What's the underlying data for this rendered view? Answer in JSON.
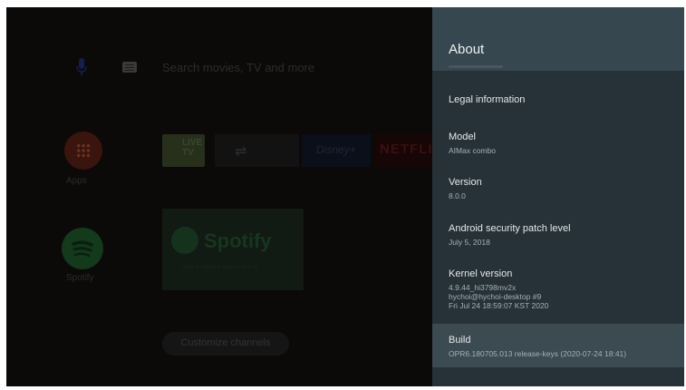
{
  "launcher": {
    "search_placeholder": "Search movies, TV and more",
    "apps_label": "Apps",
    "spotify_label": "Spotify",
    "live_tv_label": "LIVE TV",
    "disney_label": "Disney+",
    "netflix_label": "NETFLIX",
    "spotify_card_brand": "Spotify",
    "spotify_card_sub": "Listen to millions of songs on your TV",
    "customize_label": "Customize channels"
  },
  "panel": {
    "title": "About",
    "items": [
      {
        "title": "Legal information",
        "subtitle": ""
      },
      {
        "title": "Model",
        "subtitle": "AIMax combo"
      },
      {
        "title": "Version",
        "subtitle": "8.0.0"
      },
      {
        "title": "Android security patch level",
        "subtitle": "July 5, 2018"
      },
      {
        "title": "Kernel version",
        "subtitle": "4.9.44_hi3798mv2x\nhychoi@hychoi-desktop #9\nFri Jul 24 18:59:07 KST 2020"
      },
      {
        "title": "Build",
        "subtitle": "OPR6.180705.013 release-keys (2020-07-24 18:41)"
      }
    ]
  },
  "colors": {
    "panel_bg": "#263238",
    "panel_header": "#37474f",
    "selected_row": "#3c4a51"
  }
}
